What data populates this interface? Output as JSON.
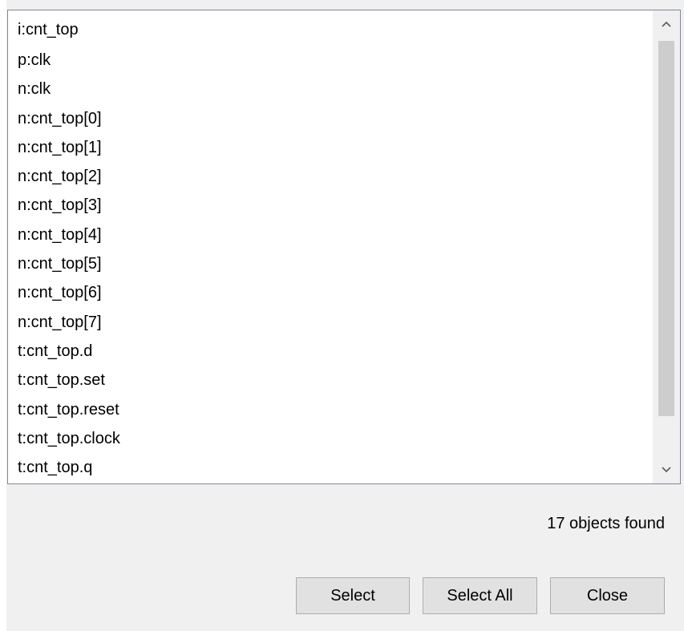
{
  "object_list": {
    "items": [
      "i:cnt_top",
      "p:clk",
      "n:clk",
      "n:cnt_top[0]",
      "n:cnt_top[1]",
      "n:cnt_top[2]",
      "n:cnt_top[3]",
      "n:cnt_top[4]",
      "n:cnt_top[5]",
      "n:cnt_top[6]",
      "n:cnt_top[7]",
      "t:cnt_top.d",
      "t:cnt_top.set",
      "t:cnt_top.reset",
      "t:cnt_top.clock",
      "t:cnt_top.q"
    ]
  },
  "scrollbar": {
    "up_icon": "chevron-up-icon",
    "down_icon": "chevron-down-icon",
    "up_glyph": "^",
    "down_glyph": "v"
  },
  "status": {
    "text": "17 objects found"
  },
  "buttons": {
    "select": "Select",
    "select_all": "Select All",
    "close": "Close"
  },
  "colors": {
    "dialog_background": "#f0f0f0",
    "list_background": "#ffffff",
    "button_background": "#e1e1e1",
    "scroll_thumb": "#cdcdcd"
  }
}
